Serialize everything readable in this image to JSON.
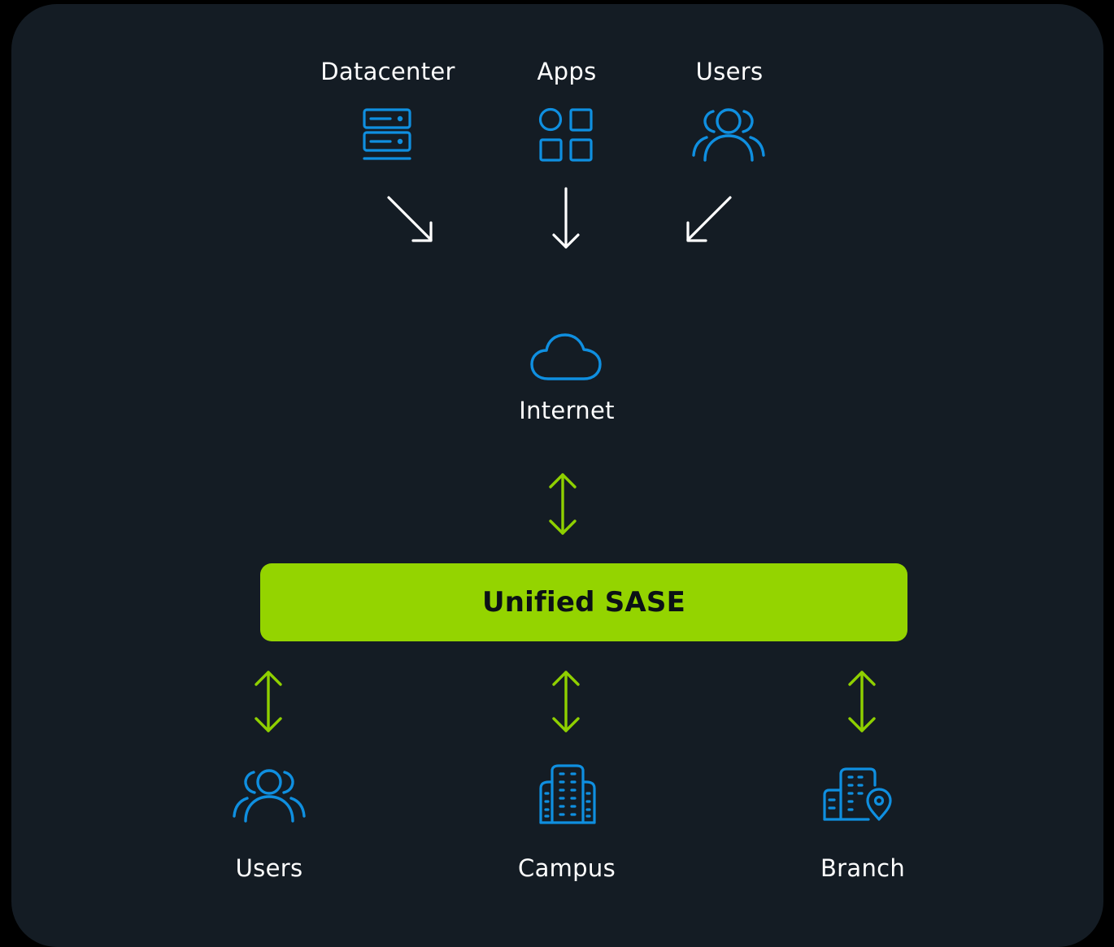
{
  "colors": {
    "background": "#000000",
    "panel": "#141c24",
    "icon_blue": "#0f8fe0",
    "arrow_white": "#ffffff",
    "arrow_green": "#8fd000",
    "sase_fill": "#94d400",
    "sase_text": "#0b1016"
  },
  "sources": [
    {
      "label": "Datacenter",
      "icon": "server-icon"
    },
    {
      "label": "Apps",
      "icon": "apps-grid-icon"
    },
    {
      "label": "Users",
      "icon": "users-icon"
    }
  ],
  "internet": {
    "label": "Internet",
    "icon": "cloud-icon"
  },
  "sase": {
    "label": "Unified SASE"
  },
  "endpoints": [
    {
      "label": "Users",
      "icon": "users-icon"
    },
    {
      "label": "Campus",
      "icon": "campus-building-icon"
    },
    {
      "label": "Branch",
      "icon": "branch-location-icon"
    }
  ]
}
